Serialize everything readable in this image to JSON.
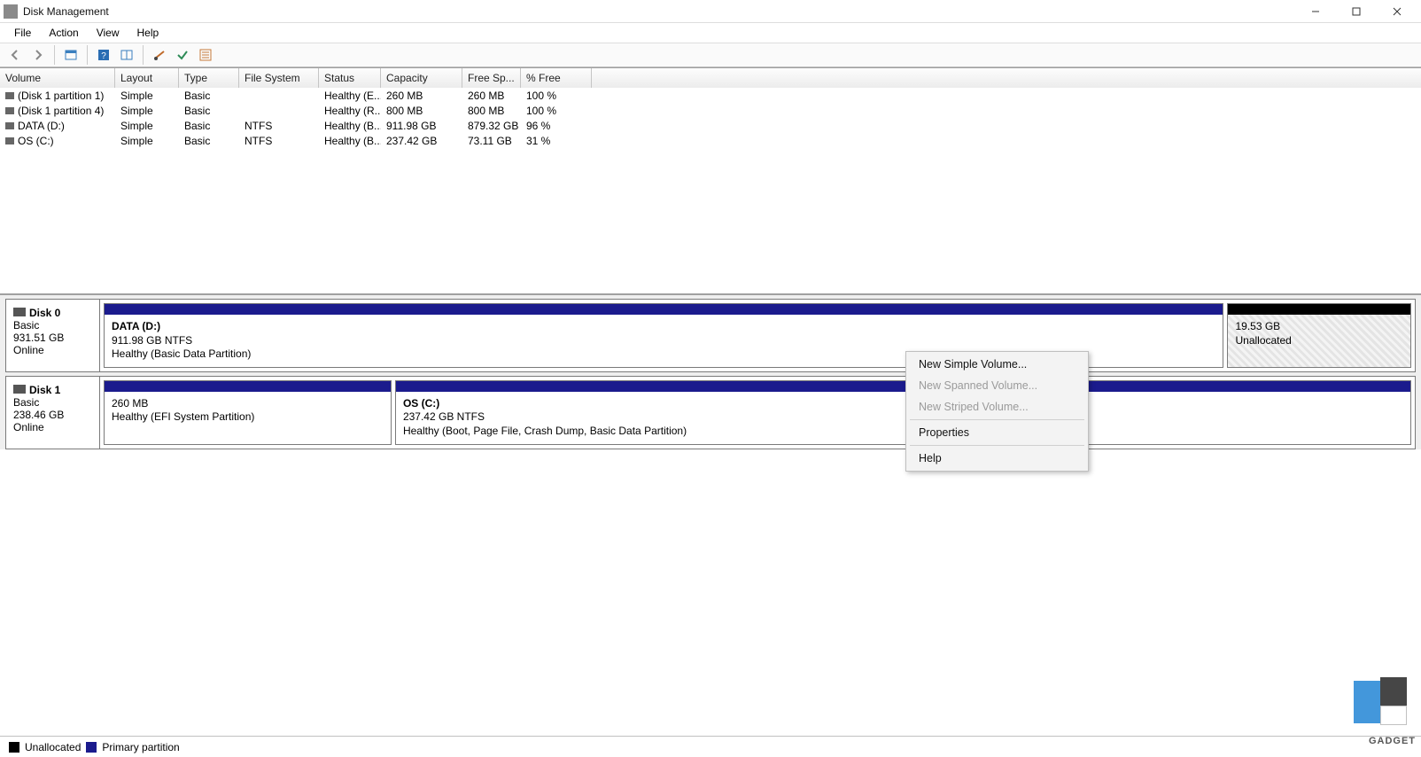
{
  "window": {
    "title": "Disk Management"
  },
  "menu": [
    "File",
    "Action",
    "View",
    "Help"
  ],
  "columns": [
    "Volume",
    "Layout",
    "Type",
    "File System",
    "Status",
    "Capacity",
    "Free Sp...",
    "% Free"
  ],
  "volumes": [
    {
      "name": "(Disk 1 partition 1)",
      "layout": "Simple",
      "type": "Basic",
      "fs": "",
      "status": "Healthy (E...",
      "capacity": "260 MB",
      "free": "260 MB",
      "pct": "100 %"
    },
    {
      "name": "(Disk 1 partition 4)",
      "layout": "Simple",
      "type": "Basic",
      "fs": "",
      "status": "Healthy (R...",
      "capacity": "800 MB",
      "free": "800 MB",
      "pct": "100 %"
    },
    {
      "name": "DATA (D:)",
      "layout": "Simple",
      "type": "Basic",
      "fs": "NTFS",
      "status": "Healthy (B...",
      "capacity": "911.98 GB",
      "free": "879.32 GB",
      "pct": "96 %"
    },
    {
      "name": "OS (C:)",
      "layout": "Simple",
      "type": "Basic",
      "fs": "NTFS",
      "status": "Healthy (B...",
      "capacity": "237.42 GB",
      "free": "73.11 GB",
      "pct": "31 %"
    }
  ],
  "disks": [
    {
      "label": "Disk 0",
      "type": "Basic",
      "size": "931.51 GB",
      "status": "Online",
      "parts": [
        {
          "kind": "primary",
          "title": "DATA  (D:)",
          "line1": "911.98 GB NTFS",
          "line2": "Healthy (Basic Data Partition)",
          "flex": 86
        },
        {
          "kind": "unalloc",
          "title": "",
          "line1": "19.53 GB",
          "line2": "Unallocated",
          "flex": 14
        }
      ]
    },
    {
      "label": "Disk 1",
      "type": "Basic",
      "size": "238.46 GB",
      "status": "Online",
      "parts": [
        {
          "kind": "primary",
          "title": "",
          "line1": "260 MB",
          "line2": "Healthy (EFI System Partition)",
          "flex": 22
        },
        {
          "kind": "primary",
          "title": "OS  (C:)",
          "line1": "237.42 GB NTFS",
          "line2": "Healthy (Boot, Page File, Crash Dump, Basic Data Partition)",
          "flex": 78
        }
      ]
    }
  ],
  "context": {
    "items": [
      {
        "label": "New Simple Volume...",
        "enabled": true
      },
      {
        "label": "New Spanned Volume...",
        "enabled": false
      },
      {
        "label": "New Striped Volume...",
        "enabled": false
      }
    ],
    "items2": [
      {
        "label": "Properties",
        "enabled": true
      }
    ],
    "items3": [
      {
        "label": "Help",
        "enabled": true
      }
    ]
  },
  "legend": {
    "unalloc": "Unallocated",
    "primary": "Primary partition"
  },
  "watermark": "GADGET"
}
